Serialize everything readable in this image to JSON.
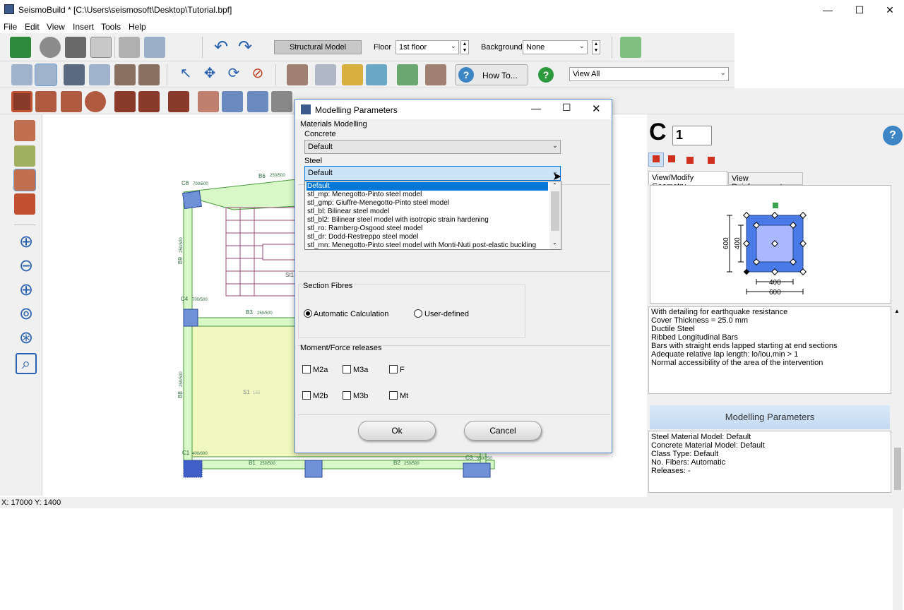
{
  "window": {
    "title": "SeismoBuild * [C:\\Users\\seismosoft\\Desktop\\Tutorial.bpf]",
    "minimize": "—",
    "maximize": "☐",
    "close": "✕"
  },
  "menu": [
    "File",
    "Edit",
    "View",
    "Insert",
    "Tools",
    "Help"
  ],
  "toolbar": {
    "mode_button": "Structural Model",
    "floor_label": "Floor",
    "floor_value": "1st floor",
    "background_label": "Background",
    "background_value": "None",
    "howto_label": "How To...",
    "view_value": "View All"
  },
  "canvas": {
    "members": [
      "C8",
      "700/500",
      "B6",
      "250/500",
      "B9",
      "250/500",
      "St1",
      "C4",
      "700/500",
      "B3",
      "250/500",
      "S1",
      "150",
      "B8",
      "250/500",
      "C1",
      "400/600",
      "B1",
      "250/500",
      "B2",
      "250/500",
      "C3",
      "550/750"
    ]
  },
  "status": {
    "coords": "X: 17000  Y: 1400"
  },
  "right_panel": {
    "element_type": "C",
    "element_id": "1",
    "tabs": [
      "View/Modify Geometry",
      "View Reinforcement"
    ],
    "dims": {
      "h_outer": "600",
      "h_inner": "400",
      "w_inner": "400",
      "w_outer": "600"
    },
    "info": [
      "With detailing for earthquake resistance",
      "Cover Thickness = 25.0 mm",
      "Ductile Steel",
      "Ribbed Longitudinal Bars",
      "Bars with straight ends lapped starting at end sections",
      "Adequate relative lap length: lo/lou,min > 1",
      "Normal accessibility of the area of the intervention"
    ],
    "modelling_header": "Modelling Parameters",
    "modelling_info": [
      "Steel Material Model: Default",
      "Concrete Material Model: Default",
      "Class Type: Default",
      "No. Fibers: Automatic",
      "Releases: -"
    ]
  },
  "dialog": {
    "title": "Modelling Parameters",
    "materials_label": "Materials Modelling",
    "concrete_label": "Concrete",
    "concrete_value": "Default",
    "steel_label": "Steel",
    "steel_value": "Default",
    "steel_options": [
      "Default",
      "stl_mp: Menegotto-Pinto steel model",
      "stl_gmp: Giuffre-Menegotto-Pinto steel model",
      "stl_bl: Bilinear steel model",
      "stl_bl2: Bilinear steel model with isotropic strain hardening",
      "stl_ro: Ramberg-Osgood steel model",
      "stl_dr: Dodd-Restreppo steel model",
      "stl_mn: Menegotto-Pinto steel model with Monti-Nuti post-elastic buckling"
    ],
    "fibres_label": "Section Fibres",
    "auto_label": "Automatic Calculation",
    "user_label": "User-defined",
    "releases_label": "Moment/Force releases",
    "releases": [
      "M2a",
      "M3a",
      "F",
      "M2b",
      "M3b",
      "Mt"
    ],
    "ok": "Ok",
    "cancel": "Cancel"
  }
}
